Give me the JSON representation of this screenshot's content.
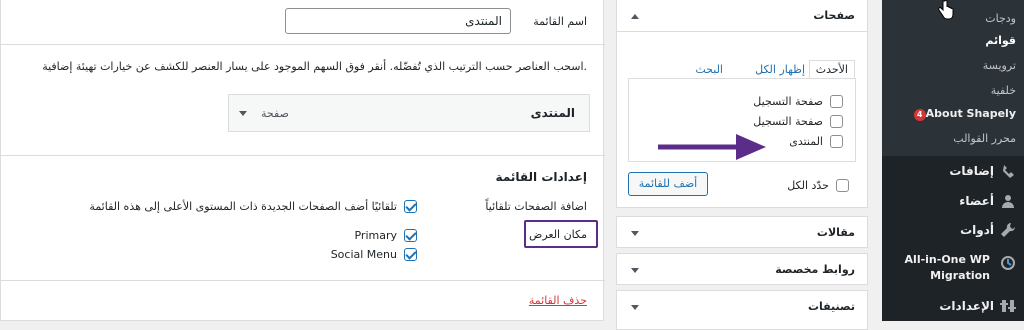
{
  "sidebar": {
    "submenu": [
      {
        "label": "ودجات",
        "current": false
      },
      {
        "label": "قوائم",
        "current": true
      },
      {
        "label": "ترويسة",
        "current": false
      },
      {
        "label": "خلفية",
        "current": false
      },
      {
        "label": "About Shapely",
        "current": false,
        "badge": "4"
      },
      {
        "label": "محرر القوالب",
        "current": false
      }
    ],
    "menu": [
      {
        "label": "إضافات",
        "icon": "plugin-icon"
      },
      {
        "label": "أعضاء",
        "icon": "users-icon"
      },
      {
        "label": "أدوات",
        "icon": "tools-icon"
      },
      {
        "label_line1": "All-in-One WP",
        "label_line2": "Migration",
        "icon": "migration-icon"
      },
      {
        "label": "الإعدادات",
        "icon": "settings-icon"
      }
    ]
  },
  "panels": {
    "pages": {
      "title": "صفحات",
      "tabs": [
        "الأحدث",
        "إظهار الكل",
        "البحث"
      ],
      "items": [
        "صفحة التسجيل",
        "صفحة التسجيل",
        "المنتدى"
      ],
      "select_all": "حدّد الكل",
      "add_button": "أضف للقائمة"
    },
    "posts": {
      "title": "مقالات"
    },
    "custom_links": {
      "title": "روابط مخصصة"
    },
    "categories": {
      "title": "تصنيفات"
    }
  },
  "editor": {
    "menu_name_label": "اسم القائمة",
    "menu_name_value": "المنتدى",
    "instructions": "اسحب العناصر حسب الترتيب الذي تُفضّله. أنقر فوق السهم الموجود على يسار العنصر للكشف عن خيارات تهيئة إضافية.",
    "menu_item": {
      "title": "المنتدى",
      "type": "صفحة"
    },
    "settings_heading": "إعدادات القائمة",
    "auto_add_label": "اضافة الصفحات تلقائياً",
    "auto_add_text": "تلقائيًا أضف الصفحات الجديدة ذات المستوى الأعلى إلى هذه القائمة",
    "display_location_label": "مكان العرض",
    "locations": [
      "Primary",
      "Social Menu"
    ],
    "delete_link": "حذف القائمة"
  },
  "colors": {
    "accent": "#2271b1",
    "annotation": "#5b2c8a",
    "danger": "#d63638"
  }
}
